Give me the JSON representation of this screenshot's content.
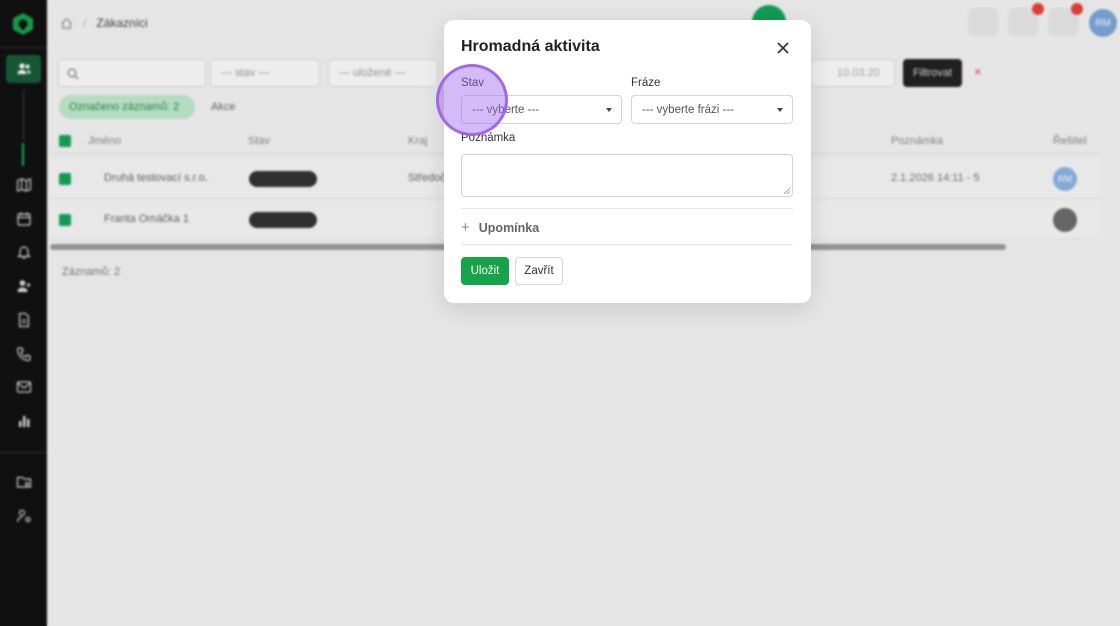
{
  "breadcrumb": {
    "title": "Zákazníci"
  },
  "filters": {
    "stav_placeholder": "--- stav ---",
    "ulozene_placeholder": "--- uložené ---",
    "date_placeholder": "10.03.20",
    "filter_button": "Filtrovat"
  },
  "chip": {
    "label": "Označeno záznamů: 2"
  },
  "toolbar": {
    "akce_label": "Akce"
  },
  "table": {
    "headers": [
      "Jméno",
      "Stav",
      "Kraj",
      "Poznámka",
      "Řešitel"
    ],
    "rows": [
      {
        "name": "Druhá testovací s.r.o.",
        "kraj": "Středoč",
        "note": "2.1.2026 14:11 - 5",
        "avatar": "RM"
      },
      {
        "name": "Franta Omáčka 1",
        "kraj": "",
        "note": "",
        "avatar": ""
      }
    ],
    "records_label": "Záznamů: 2"
  },
  "user": {
    "initials": "RM"
  },
  "modal": {
    "title": "Hromadná aktivita",
    "stav_label": "Stav",
    "stav_placeholder": "--- vyberte ---",
    "fraze_label": "Fráze",
    "fraze_placeholder": "--- vyberte frázi ---",
    "poznamka_label": "Poznámka",
    "upominka_label": "Upomínka",
    "save_label": "Uložit",
    "close_label": "Zavřít"
  },
  "colors": {
    "accent": "#16a34a",
    "sidebar": "#111111",
    "cursor": "#9b69eb"
  }
}
